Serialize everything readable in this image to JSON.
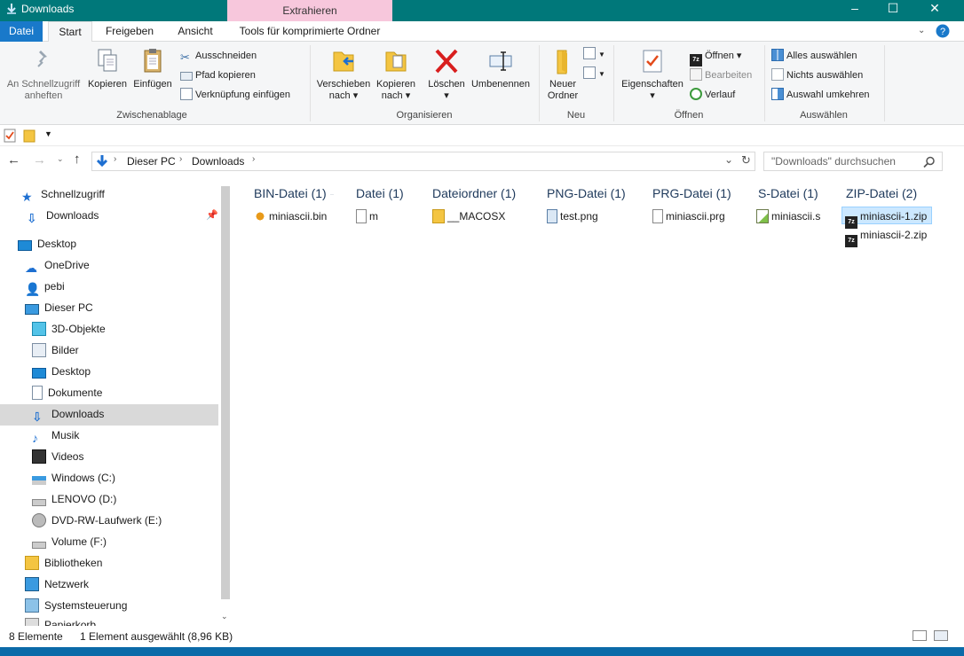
{
  "window": {
    "title": "Downloads",
    "context_tab": "Extrahieren"
  },
  "tabs": {
    "file": "Datei",
    "start": "Start",
    "share": "Freigeben",
    "view": "Ansicht",
    "tools": "Tools für komprimierte Ordner"
  },
  "ribbon": {
    "pin": [
      "An Schnellzugriff",
      "anheften"
    ],
    "copy": "Kopieren",
    "paste": "Einfügen",
    "cut": "Ausschneiden",
    "copy_path": "Pfad kopieren",
    "paste_shortcut": "Verknüpfung einfügen",
    "clipboard_label": "Zwischenablage",
    "move_to": [
      "Verschieben",
      "nach ▾"
    ],
    "copy_to": [
      "Kopieren",
      "nach ▾"
    ],
    "delete": [
      "Löschen",
      "▾"
    ],
    "rename": "Umbenennen",
    "organize_label": "Organisieren",
    "new_folder": [
      "Neuer",
      "Ordner"
    ],
    "new_label": "Neu",
    "properties": [
      "Eigenschaften",
      "▾"
    ],
    "open": "Öffnen ▾",
    "edit": "Bearbeiten",
    "history": "Verlauf",
    "open_label": "Öffnen",
    "select_all": "Alles auswählen",
    "select_none": "Nichts auswählen",
    "invert_selection": "Auswahl umkehren",
    "select_label": "Auswählen"
  },
  "address": {
    "crumbs": [
      "Dieser PC",
      "Downloads"
    ],
    "search_placeholder": "\"Downloads\" durchsuchen"
  },
  "nav": {
    "quick_access": "Schnellzugriff",
    "downloads_pin": "Downloads",
    "desktop_root": "Desktop",
    "onedrive": "OneDrive",
    "user": "pebi",
    "this_pc": "Dieser PC",
    "objects3d": "3D-Objekte",
    "pictures": "Bilder",
    "desktop": "Desktop",
    "documents": "Dokumente",
    "downloads": "Downloads",
    "music": "Musik",
    "videos": "Videos",
    "drive_c": "Windows (C:)",
    "drive_d": "LENOVO (D:)",
    "drive_e": "DVD-RW-Laufwerk (E:)",
    "drive_f": "Volume (F:)",
    "libraries": "Bibliotheken",
    "network": "Netzwerk",
    "control_panel": "Systemsteuerung",
    "recycle_partial": "Papierkorb"
  },
  "groups": [
    {
      "header": "BIN-Datei (1)",
      "files": [
        "miniascii.bin"
      ]
    },
    {
      "header": "Datei (1)",
      "files": [
        "m"
      ]
    },
    {
      "header": "Dateiordner (1)",
      "files": [
        "__MACOSX"
      ]
    },
    {
      "header": "PNG-Datei (1)",
      "files": [
        "test.png"
      ]
    },
    {
      "header": "PRG-Datei (1)",
      "files": [
        "miniascii.prg"
      ]
    },
    {
      "header": "S-Datei (1)",
      "files": [
        "miniascii.s"
      ]
    },
    {
      "header": "ZIP-Datei (2)",
      "files": [
        "miniascii-1.zip",
        "miniascii-2.zip"
      ]
    }
  ],
  "status": {
    "count": "8 Elemente",
    "selection": "1 Element ausgewählt (8,96 KB)"
  },
  "colors": {
    "titlebar": "#00787a",
    "context_tab": "#f7c7dc",
    "file_tab": "#1979ca",
    "selection": "#cce8ff",
    "group_header": "#1e395b"
  }
}
